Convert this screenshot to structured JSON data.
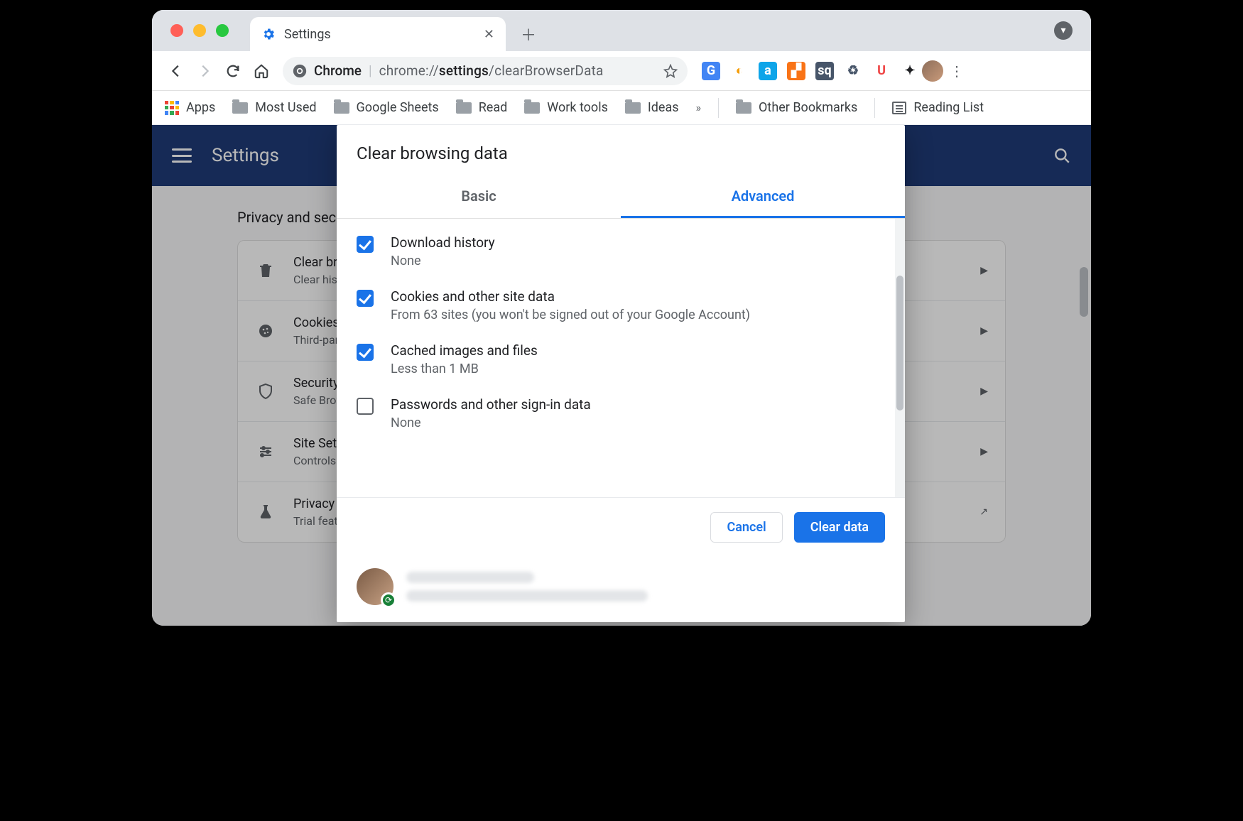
{
  "titlebar": {
    "tab_title": "Settings"
  },
  "toolbar": {
    "omnibox_label": "Chrome",
    "omnibox_url_prefix": "chrome://",
    "omnibox_url_bold": "settings",
    "omnibox_url_suffix": "/clearBrowserData"
  },
  "bookmarks": {
    "apps": "Apps",
    "items": [
      "Most Used",
      "Google Sheets",
      "Read",
      "Work tools",
      "Ideas"
    ],
    "overflow": "»",
    "other": "Other Bookmarks",
    "reading": "Reading List"
  },
  "extensions": [
    {
      "name": "translate-icon",
      "bg": "#4285f4",
      "fg": "#fff",
      "text": "G"
    },
    {
      "name": "similarweb-icon",
      "bg": "#fff",
      "fg": "#f59e0b",
      "text": "◐"
    },
    {
      "name": "amazon-icon",
      "bg": "#0ea5e9",
      "fg": "#fff",
      "text": "a"
    },
    {
      "name": "analytics-icon",
      "bg": "#f97316",
      "fg": "#fff",
      "text": "▞"
    },
    {
      "name": "soundcloud-icon",
      "bg": "#475569",
      "fg": "#fff",
      "text": "sq"
    },
    {
      "name": "recycle-icon",
      "bg": "#fff",
      "fg": "#475569",
      "text": "♻"
    },
    {
      "name": "ublock-icon",
      "bg": "#fff",
      "fg": "#ef4444",
      "text": "U"
    },
    {
      "name": "puzzle-icon",
      "bg": "#fff",
      "fg": "#202124",
      "text": "✦"
    }
  ],
  "settings": {
    "header": "Settings",
    "section": "Privacy and security",
    "rows": [
      {
        "icon": "trash-icon",
        "t1": "Clear browsing data",
        "t2": "Clear history, cookies, cache, and more"
      },
      {
        "icon": "cookie-icon",
        "t1": "Cookies and other site data",
        "t2": "Third-party cookies are blocked in Incognito mode"
      },
      {
        "icon": "shield-icon",
        "t1": "Security",
        "t2": "Safe Browsing (protection from dangerous sites) and other security settings"
      },
      {
        "icon": "sliders-icon",
        "t1": "Site Settings",
        "t2": "Controls what information sites can use and show"
      },
      {
        "icon": "flask-icon",
        "t1": "Privacy Sandbox",
        "t2": "Trial features are on"
      }
    ]
  },
  "dialog": {
    "title": "Clear browsing data",
    "tabs": {
      "basic": "Basic",
      "advanced": "Advanced"
    },
    "items": [
      {
        "checked": true,
        "t1": "Download history",
        "t2": "None"
      },
      {
        "checked": true,
        "t1": "Cookies and other site data",
        "t2": "From 63 sites (you won't be signed out of your Google Account)"
      },
      {
        "checked": true,
        "t1": "Cached images and files",
        "t2": "Less than 1 MB"
      },
      {
        "checked": false,
        "t1": "Passwords and other sign-in data",
        "t2": "None"
      }
    ],
    "cancel": "Cancel",
    "confirm": "Clear data"
  }
}
